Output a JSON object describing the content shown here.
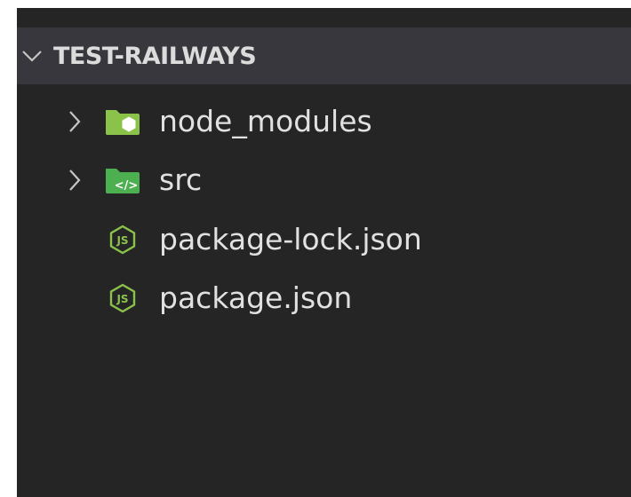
{
  "explorer": {
    "folder_name": "TEST-RAILWAYS",
    "items": [
      {
        "label": "node_modules",
        "type": "folder",
        "icon": "node-modules-folder-icon",
        "expandable": true
      },
      {
        "label": "src",
        "type": "folder",
        "icon": "src-folder-icon",
        "expandable": true
      },
      {
        "label": "package-lock.json",
        "type": "file",
        "icon": "js-json-icon",
        "expandable": false
      },
      {
        "label": "package.json",
        "type": "file",
        "icon": "js-json-icon",
        "expandable": false
      }
    ]
  },
  "colors": {
    "panel_bg": "#252526",
    "header_bg": "#37373d",
    "text": "#e1e1e1",
    "icon_green": "#8bc34a"
  }
}
